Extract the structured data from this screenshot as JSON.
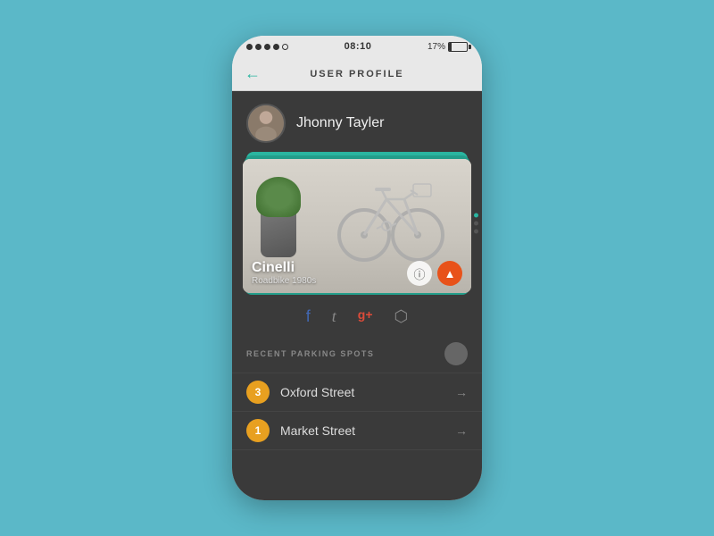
{
  "statusBar": {
    "time": "08:10",
    "battery": "17%"
  },
  "header": {
    "title": "USER PROFILE",
    "backLabel": "←"
  },
  "user": {
    "name": "Jhonny Tayler"
  },
  "bike": {
    "name": "Cinelli",
    "description": "Roadbike 1980s"
  },
  "social": {
    "facebook": "f",
    "twitter": "t",
    "googleplus": "g+",
    "instagram": "◻"
  },
  "parking": {
    "sectionLabel": "RECENT PARKING SPOTS",
    "items": [
      {
        "badge": "3",
        "name": "Oxford Street"
      },
      {
        "badge": "1",
        "name": "Market Street"
      }
    ]
  },
  "actions": {
    "info": "ℹ",
    "alert": "⚠"
  }
}
